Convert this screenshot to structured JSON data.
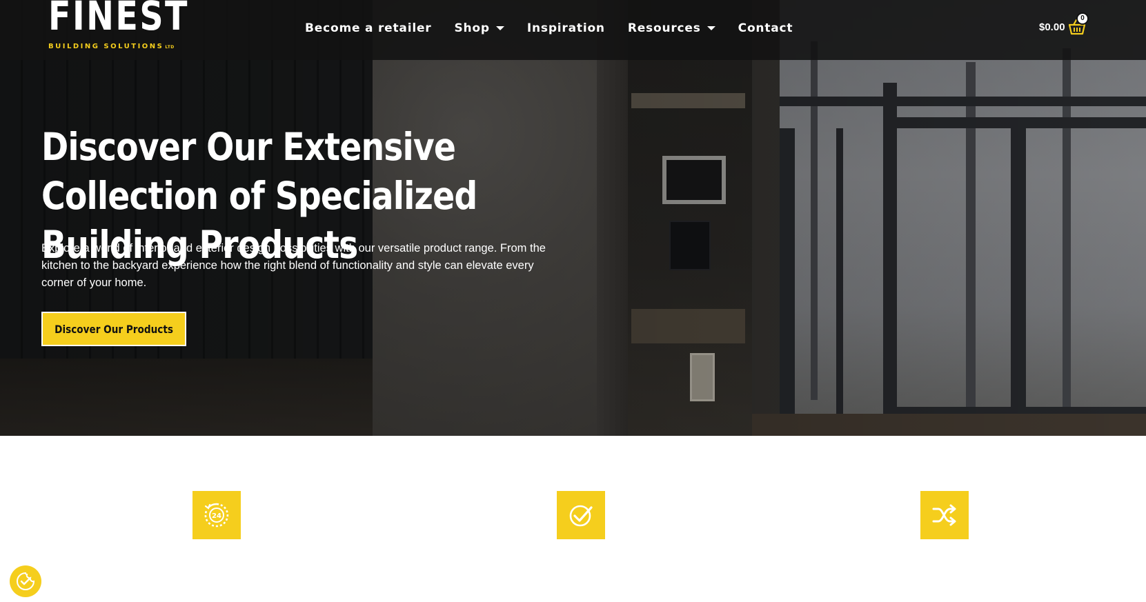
{
  "brand": {
    "name": "FINEST",
    "tagline": "BUILDING SOLUTIONS",
    "mark": "LTD",
    "accent_color": "#f5ce1d"
  },
  "nav": {
    "items": [
      {
        "label": "Become a retailer",
        "has_dropdown": false
      },
      {
        "label": "Shop",
        "has_dropdown": true
      },
      {
        "label": "Inspiration",
        "has_dropdown": false
      },
      {
        "label": "Resources",
        "has_dropdown": true
      },
      {
        "label": "Contact",
        "has_dropdown": false
      }
    ]
  },
  "cart": {
    "total": "$0.00",
    "count": "0",
    "icon": "basket-icon"
  },
  "hero": {
    "title": "Discover Our Extensive Collection of Specialized Building Products",
    "text": "Explore a world of interior and exterior design possibilities with our versatile product range. From the kitchen to the backyard experience how the right blend of functionality and style can elevate every corner of your home.",
    "button_label": "Discover Our Products"
  },
  "features": [
    {
      "icon": "clock-24-icon"
    },
    {
      "icon": "check-badge-icon"
    },
    {
      "icon": "shuffle-icon"
    }
  ],
  "floating_button": {
    "icon": "cookie-consent-icon"
  }
}
